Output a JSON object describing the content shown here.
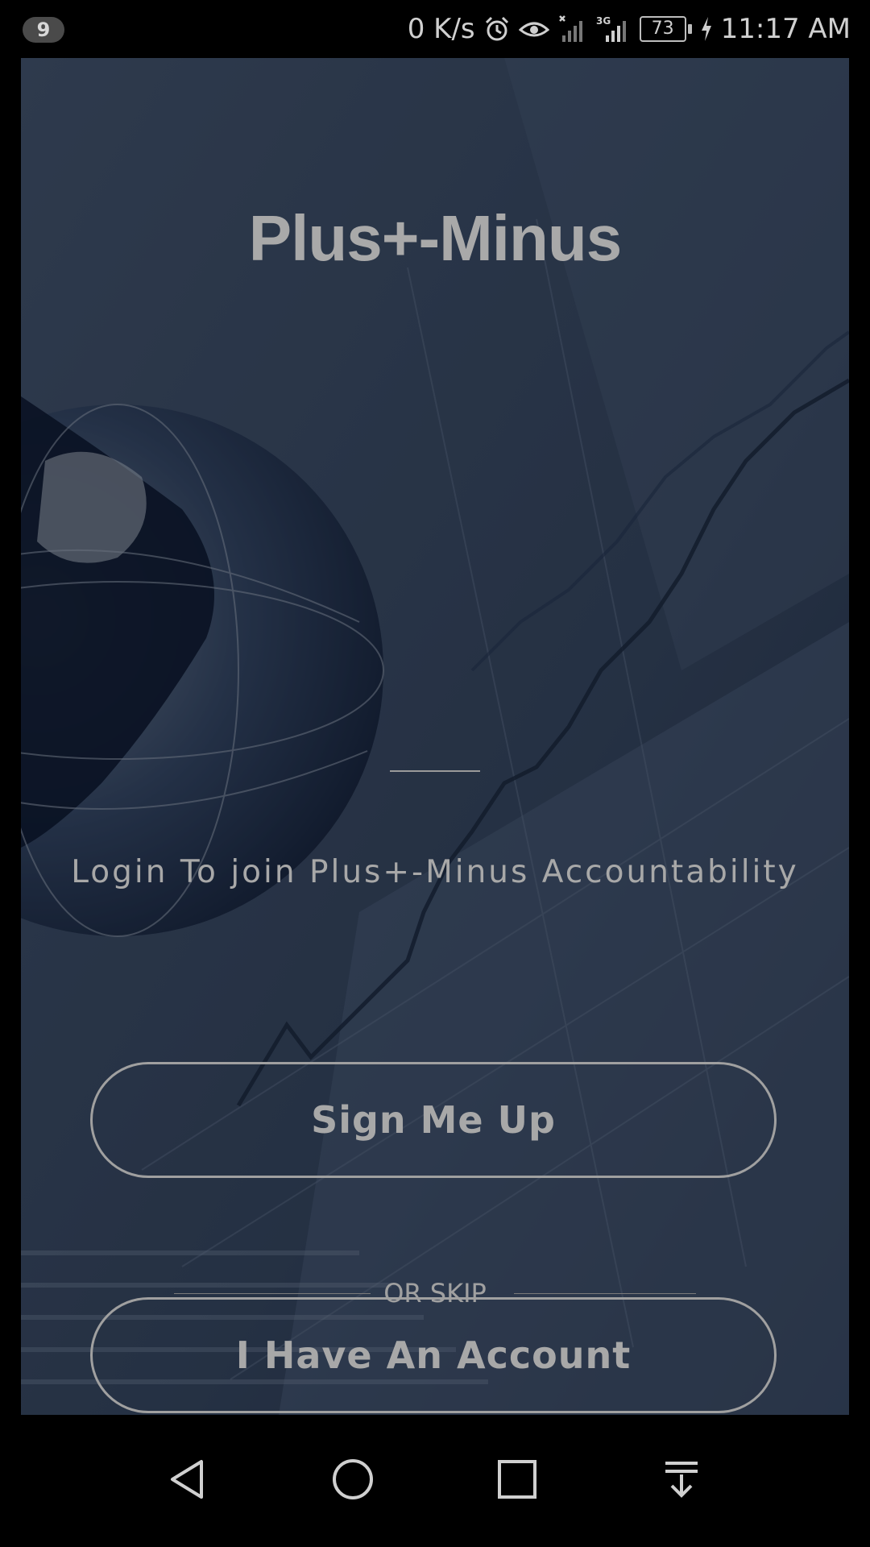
{
  "status_bar": {
    "notification_count": "9",
    "net_speed": "0 K/s",
    "network_type": "3G",
    "battery_level": "73",
    "time": "11:17 AM",
    "icons": [
      "alarm-icon",
      "eye-icon",
      "signal-muted-icon",
      "signal-3g-icon",
      "battery-icon",
      "charging-icon"
    ]
  },
  "app": {
    "title": "Plus+-Minus",
    "tagline": "Login To join Plus+-Minus Accountability",
    "sign_up_label": "Sign Me Up",
    "or_skip_label": "OR SKIP",
    "account_label": "I Have An  Account"
  },
  "nav_bar": {
    "icons": [
      "back-icon",
      "home-icon",
      "recents-icon",
      "notification-pull-icon"
    ]
  },
  "colors": {
    "overlay_text": "#a8a8a8",
    "background_tint": "#2c3b52"
  }
}
